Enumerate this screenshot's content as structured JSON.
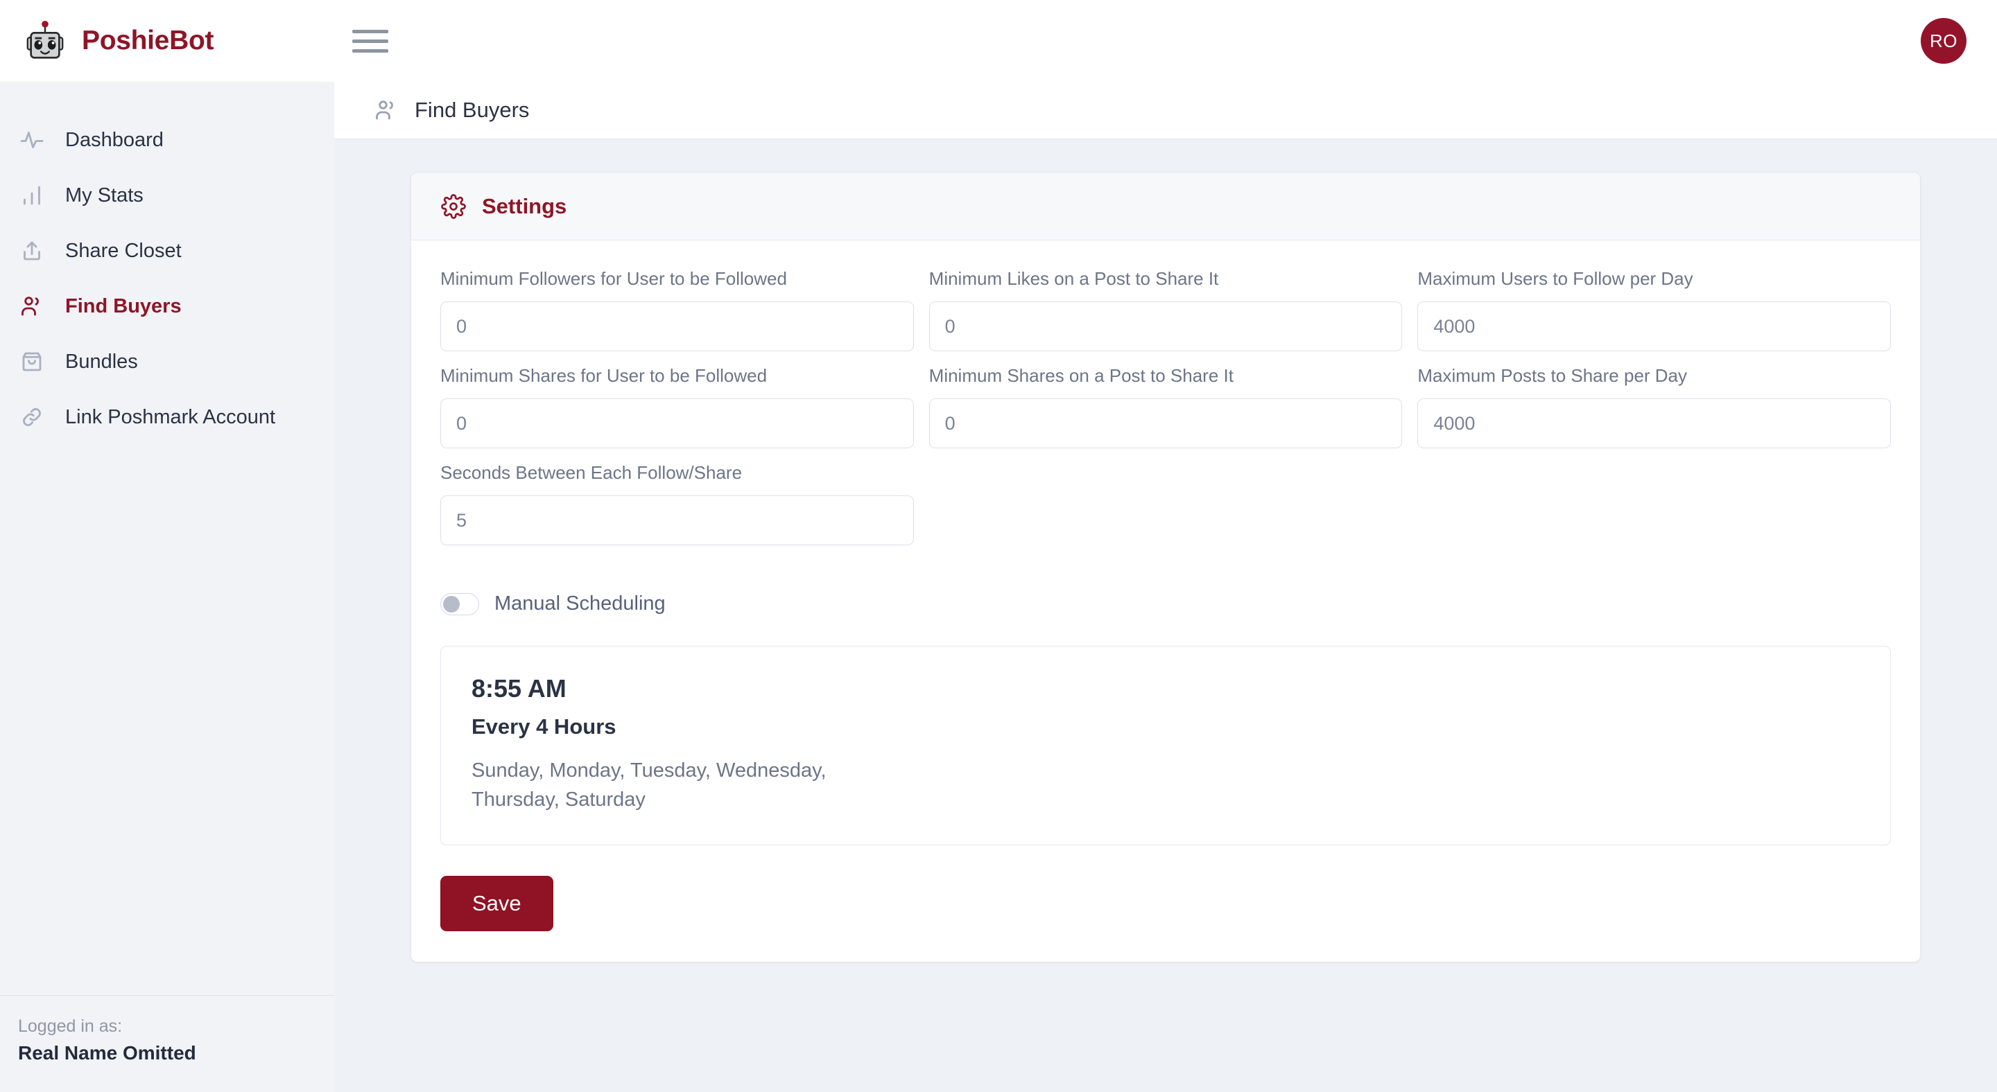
{
  "brand": {
    "name": "PoshieBot",
    "logo_icon": "robot-icon",
    "color": "#8f1526"
  },
  "topbar": {
    "menu_icon": "hamburger-menu-icon",
    "avatar_initials": "RO",
    "avatar_color": "#93132a"
  },
  "sidebar": {
    "items": [
      {
        "label": "Dashboard",
        "icon": "activity-pulse-icon",
        "active": false
      },
      {
        "label": "My Stats",
        "icon": "bar-chart-icon",
        "active": false
      },
      {
        "label": "Share Closet",
        "icon": "upload-icon",
        "active": false
      },
      {
        "label": "Find Buyers",
        "icon": "users-icon",
        "active": true
      },
      {
        "label": "Bundles",
        "icon": "shopping-bag-icon",
        "active": false
      },
      {
        "label": "Link Poshmark Account",
        "icon": "link-chain-icon",
        "active": false
      }
    ],
    "footer": {
      "logged_in_label": "Logged in as:",
      "user_name": "Real Name Omitted"
    }
  },
  "page": {
    "title": "Find Buyers",
    "title_icon": "users-icon"
  },
  "settings_card": {
    "title": "Settings",
    "icon": "gear-icon",
    "fields": [
      {
        "label": "Minimum Followers for User to be Followed",
        "value": "0",
        "name": "min-followers-input"
      },
      {
        "label": "Minimum Likes on a Post to Share It",
        "value": "0",
        "name": "min-likes-input"
      },
      {
        "label": "Maximum Users to Follow per Day",
        "value": "4000",
        "name": "max-users-follow-input"
      },
      {
        "label": "Minimum Shares for User to be Followed",
        "value": "0",
        "name": "min-shares-user-input"
      },
      {
        "label": "Minimum Shares on a Post to Share It",
        "value": "0",
        "name": "min-shares-post-input"
      },
      {
        "label": "Maximum Posts to Share per Day",
        "value": "4000",
        "name": "max-posts-share-input"
      }
    ],
    "seconds_field": {
      "label": "Seconds Between Each Follow/Share",
      "value": "5"
    },
    "toggle": {
      "label": "Manual Scheduling",
      "state": "off"
    },
    "schedule": {
      "time": "8:55 AM",
      "frequency": "Every 4 Hours",
      "days": "Sunday, Monday, Tuesday, Wednesday, Thursday, Saturday"
    },
    "save_label": "Save"
  }
}
